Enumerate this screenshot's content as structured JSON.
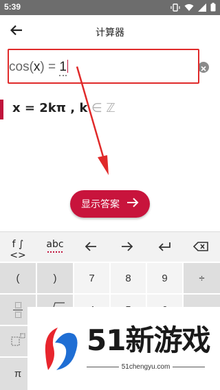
{
  "status_bar": {
    "time": "5:39",
    "icons": [
      "vibrate-icon",
      "wifi-icon",
      "signal-icon",
      "battery-icon"
    ]
  },
  "app_bar": {
    "back_icon": "arrow-left-icon",
    "title": "计算器"
  },
  "input": {
    "prefix": "cos(",
    "variable": "x",
    "suffix": ") = ",
    "value": "1",
    "clear_icon": "clear-icon"
  },
  "answer": {
    "main": "x = 2kπ , k",
    "set": " ∈ ℤ"
  },
  "show_answer_button": {
    "label": "显示答案",
    "icon": "arrow-right-icon"
  },
  "keyboard": {
    "tabs": [
      {
        "label": "f ∫ <>"
      },
      {
        "label": "abc"
      }
    ],
    "tools": [
      "arrow-left-icon",
      "arrow-right-icon",
      "enter-icon",
      "backspace-icon"
    ],
    "keys": {
      "open_paren": "(",
      "close_paren": ")",
      "seven": "7",
      "eight": "8",
      "nine": "9",
      "divide": "÷",
      "four": "4",
      "five": "5",
      "six": "6",
      "pi": "π"
    }
  },
  "watermark": {
    "brand": "51新游戏",
    "url": "51chengyu.com"
  },
  "colors": {
    "accent": "#c8143c",
    "highlight": "#e02a2a",
    "status_bar": "#6d6d6d"
  }
}
